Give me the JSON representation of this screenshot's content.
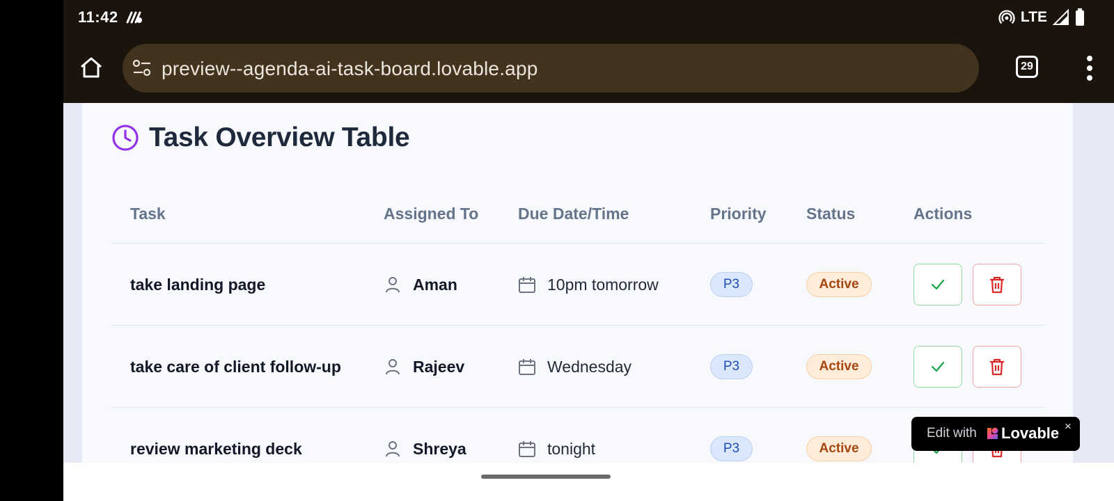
{
  "status_bar": {
    "time": "11:42",
    "network": "LTE",
    "icons": [
      "notification-icon",
      "hotspot-icon",
      "signal-icon",
      "battery-icon"
    ]
  },
  "browser": {
    "url": "preview--agenda-ai-task-board.lovable.app",
    "tab_count": "29"
  },
  "page": {
    "title": "Task Overview Table",
    "title_icon": "clock-icon",
    "accent_color": "#9333ea",
    "columns": [
      "Task",
      "Assigned To",
      "Due Date/Time",
      "Priority",
      "Status",
      "Actions"
    ],
    "rows": [
      {
        "task": "take landing page",
        "assignee": "Aman",
        "due": "10pm tomorrow",
        "priority": "P3",
        "status": "Active"
      },
      {
        "task": "take care of client follow-up",
        "assignee": "Rajeev",
        "due": "Wednesday",
        "priority": "P3",
        "status": "Active"
      },
      {
        "task": "review marketing deck",
        "assignee": "Shreya",
        "due": "tonight",
        "priority": "P3",
        "status": "Active"
      }
    ]
  },
  "lovable_badge": {
    "edit_text": "Edit with",
    "brand": "Lovable",
    "close": "×"
  }
}
